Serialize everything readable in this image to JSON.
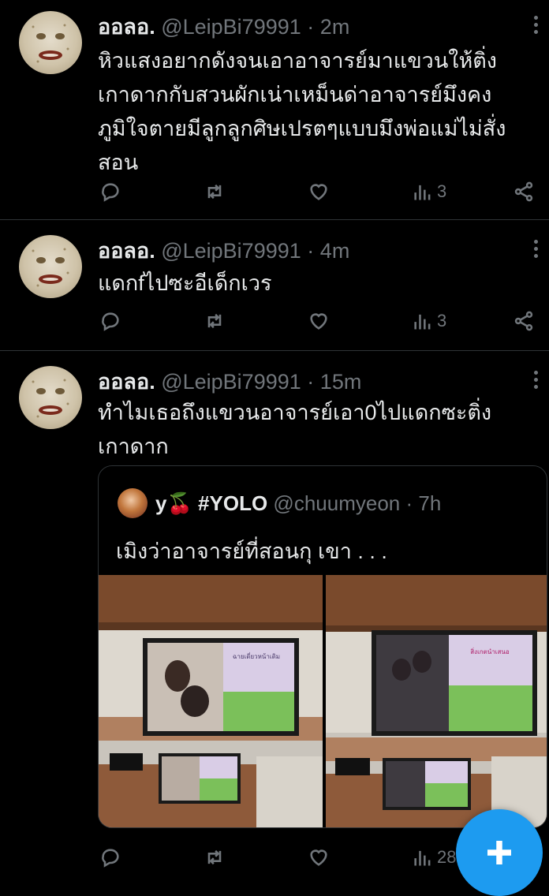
{
  "tweets": [
    {
      "name": "ออลอ.",
      "handle": "@LeipBi79991",
      "time": "2m",
      "lines": [
        "หิวแสงอยากดังจนเอาอาจารย์มาแขวนให้ติ่ง",
        "เกาดากกับสวนผักเน่าเหม็นด่าอาจารย์มึงคง",
        "ภูมิใจตายมีลูกลูกศิษเปรตๆแบบมึงพ่อแม่ไม่สั่ง",
        "สอน"
      ],
      "views": "3"
    },
    {
      "name": "ออลอ.",
      "handle": "@LeipBi79991",
      "time": "4m",
      "lines": [
        "แดกfไปซะอีเด็กเวร"
      ],
      "views": "3"
    },
    {
      "name": "ออลอ.",
      "handle": "@LeipBi79991",
      "time": "15m",
      "lines": [
        "ทำไมเธอถึงแขวนอาจารย์เอา0ไปแดกซะติ่ง",
        "เกาดาก"
      ],
      "views": "28"
    }
  ],
  "quote": {
    "name": "y🍒 #YOLO",
    "handle": "@chuumyeon",
    "time": "7h",
    "text": "เมิงว่าอาจารย์ที่สอนกุ เขา . . .",
    "slides": [
      {
        "title": "ฉายเดี่ยวหน้าเดิม"
      },
      {
        "title": "สิ่งเกตนำเสนอ"
      }
    ]
  },
  "separator": "·",
  "icons": {
    "reply": "reply-icon",
    "retweet": "retweet-icon",
    "like": "heart-icon",
    "views": "views-icon",
    "share": "share-icon",
    "more": "more-icon",
    "compose": "plus-icon"
  },
  "colors": {
    "background": "#000000",
    "text": "#e7e9ea",
    "muted": "#71767b",
    "accent": "#1d9bf0",
    "divider": "#2f3336"
  }
}
